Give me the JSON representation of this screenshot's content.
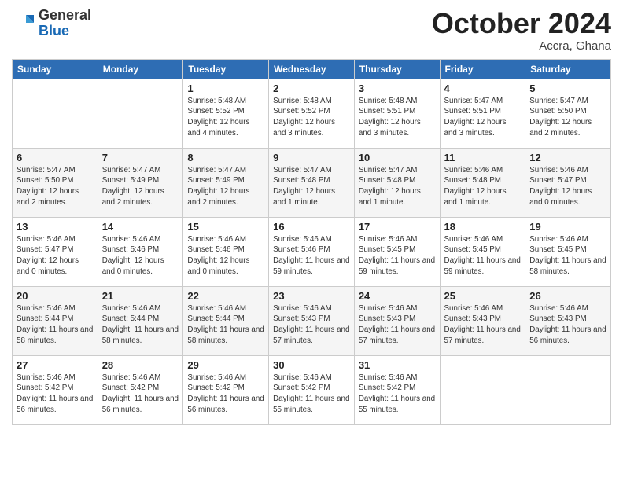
{
  "logo": {
    "general": "General",
    "blue": "Blue"
  },
  "header": {
    "month": "October 2024",
    "location": "Accra, Ghana"
  },
  "weekdays": [
    "Sunday",
    "Monday",
    "Tuesday",
    "Wednesday",
    "Thursday",
    "Friday",
    "Saturday"
  ],
  "weeks": [
    [
      {
        "day": "",
        "info": ""
      },
      {
        "day": "",
        "info": ""
      },
      {
        "day": "1",
        "info": "Sunrise: 5:48 AM\nSunset: 5:52 PM\nDaylight: 12 hours and 4 minutes."
      },
      {
        "day": "2",
        "info": "Sunrise: 5:48 AM\nSunset: 5:52 PM\nDaylight: 12 hours and 3 minutes."
      },
      {
        "day": "3",
        "info": "Sunrise: 5:48 AM\nSunset: 5:51 PM\nDaylight: 12 hours and 3 minutes."
      },
      {
        "day": "4",
        "info": "Sunrise: 5:47 AM\nSunset: 5:51 PM\nDaylight: 12 hours and 3 minutes."
      },
      {
        "day": "5",
        "info": "Sunrise: 5:47 AM\nSunset: 5:50 PM\nDaylight: 12 hours and 2 minutes."
      }
    ],
    [
      {
        "day": "6",
        "info": "Sunrise: 5:47 AM\nSunset: 5:50 PM\nDaylight: 12 hours and 2 minutes."
      },
      {
        "day": "7",
        "info": "Sunrise: 5:47 AM\nSunset: 5:49 PM\nDaylight: 12 hours and 2 minutes."
      },
      {
        "day": "8",
        "info": "Sunrise: 5:47 AM\nSunset: 5:49 PM\nDaylight: 12 hours and 2 minutes."
      },
      {
        "day": "9",
        "info": "Sunrise: 5:47 AM\nSunset: 5:48 PM\nDaylight: 12 hours and 1 minute."
      },
      {
        "day": "10",
        "info": "Sunrise: 5:47 AM\nSunset: 5:48 PM\nDaylight: 12 hours and 1 minute."
      },
      {
        "day": "11",
        "info": "Sunrise: 5:46 AM\nSunset: 5:48 PM\nDaylight: 12 hours and 1 minute."
      },
      {
        "day": "12",
        "info": "Sunrise: 5:46 AM\nSunset: 5:47 PM\nDaylight: 12 hours and 0 minutes."
      }
    ],
    [
      {
        "day": "13",
        "info": "Sunrise: 5:46 AM\nSunset: 5:47 PM\nDaylight: 12 hours and 0 minutes."
      },
      {
        "day": "14",
        "info": "Sunrise: 5:46 AM\nSunset: 5:46 PM\nDaylight: 12 hours and 0 minutes."
      },
      {
        "day": "15",
        "info": "Sunrise: 5:46 AM\nSunset: 5:46 PM\nDaylight: 12 hours and 0 minutes."
      },
      {
        "day": "16",
        "info": "Sunrise: 5:46 AM\nSunset: 5:46 PM\nDaylight: 11 hours and 59 minutes."
      },
      {
        "day": "17",
        "info": "Sunrise: 5:46 AM\nSunset: 5:45 PM\nDaylight: 11 hours and 59 minutes."
      },
      {
        "day": "18",
        "info": "Sunrise: 5:46 AM\nSunset: 5:45 PM\nDaylight: 11 hours and 59 minutes."
      },
      {
        "day": "19",
        "info": "Sunrise: 5:46 AM\nSunset: 5:45 PM\nDaylight: 11 hours and 58 minutes."
      }
    ],
    [
      {
        "day": "20",
        "info": "Sunrise: 5:46 AM\nSunset: 5:44 PM\nDaylight: 11 hours and 58 minutes."
      },
      {
        "day": "21",
        "info": "Sunrise: 5:46 AM\nSunset: 5:44 PM\nDaylight: 11 hours and 58 minutes."
      },
      {
        "day": "22",
        "info": "Sunrise: 5:46 AM\nSunset: 5:44 PM\nDaylight: 11 hours and 58 minutes."
      },
      {
        "day": "23",
        "info": "Sunrise: 5:46 AM\nSunset: 5:43 PM\nDaylight: 11 hours and 57 minutes."
      },
      {
        "day": "24",
        "info": "Sunrise: 5:46 AM\nSunset: 5:43 PM\nDaylight: 11 hours and 57 minutes."
      },
      {
        "day": "25",
        "info": "Sunrise: 5:46 AM\nSunset: 5:43 PM\nDaylight: 11 hours and 57 minutes."
      },
      {
        "day": "26",
        "info": "Sunrise: 5:46 AM\nSunset: 5:43 PM\nDaylight: 11 hours and 56 minutes."
      }
    ],
    [
      {
        "day": "27",
        "info": "Sunrise: 5:46 AM\nSunset: 5:42 PM\nDaylight: 11 hours and 56 minutes."
      },
      {
        "day": "28",
        "info": "Sunrise: 5:46 AM\nSunset: 5:42 PM\nDaylight: 11 hours and 56 minutes."
      },
      {
        "day": "29",
        "info": "Sunrise: 5:46 AM\nSunset: 5:42 PM\nDaylight: 11 hours and 56 minutes."
      },
      {
        "day": "30",
        "info": "Sunrise: 5:46 AM\nSunset: 5:42 PM\nDaylight: 11 hours and 55 minutes."
      },
      {
        "day": "31",
        "info": "Sunrise: 5:46 AM\nSunset: 5:42 PM\nDaylight: 11 hours and 55 minutes."
      },
      {
        "day": "",
        "info": ""
      },
      {
        "day": "",
        "info": ""
      }
    ]
  ]
}
